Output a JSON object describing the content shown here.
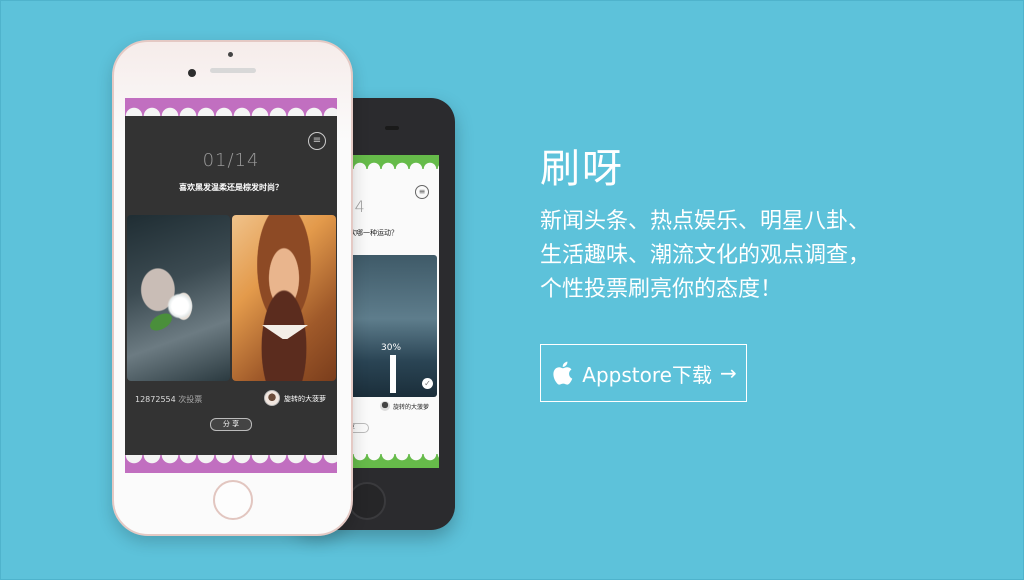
{
  "brand": {
    "title": "刷呀",
    "description_lines": [
      "新闻头条、热点娱乐、明星八卦、",
      "生活趣味、潮流文化的观点调查，",
      "个性投票刷亮你的态度！"
    ]
  },
  "download_button": {
    "label": "Appstore下载",
    "arrow": "→",
    "icon": "apple-icon"
  },
  "front_app": {
    "counter": "01/14",
    "question": "喜欢黑发温柔还是棕发时尚？",
    "vote_count": "12872554",
    "vote_unit": "次投票",
    "user_name": "旋转的大菠萝",
    "share_label": "分 享",
    "menu_icon": "menu-icon"
  },
  "back_app": {
    "counter_partial": "/14",
    "question_partial": "欢哪一种运动？",
    "percent": "30%",
    "user_name": "旋转的大菠萝",
    "share_partial": "享"
  },
  "colors": {
    "background": "#5dc2da",
    "front_accent": "#c16fc0",
    "back_accent": "#66bb4a"
  }
}
